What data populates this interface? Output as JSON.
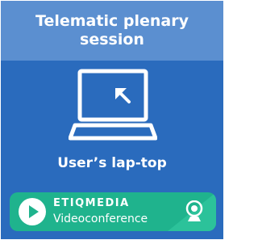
{
  "header": {
    "title": "Telematic plenary session"
  },
  "device": {
    "label": "User’s lap-top"
  },
  "brand": {
    "name": "ETIQMEDIA",
    "subtitle": "Videoconference"
  },
  "icons": {
    "laptop": "laptop-icon",
    "cursor": "cursor-icon",
    "play": "play-icon",
    "webcam": "webcam-icon"
  },
  "colors": {
    "background": "#2a6bbd",
    "header": "#5b8fd0",
    "brand_green": "#1fb38d",
    "white": "#ffffff"
  }
}
